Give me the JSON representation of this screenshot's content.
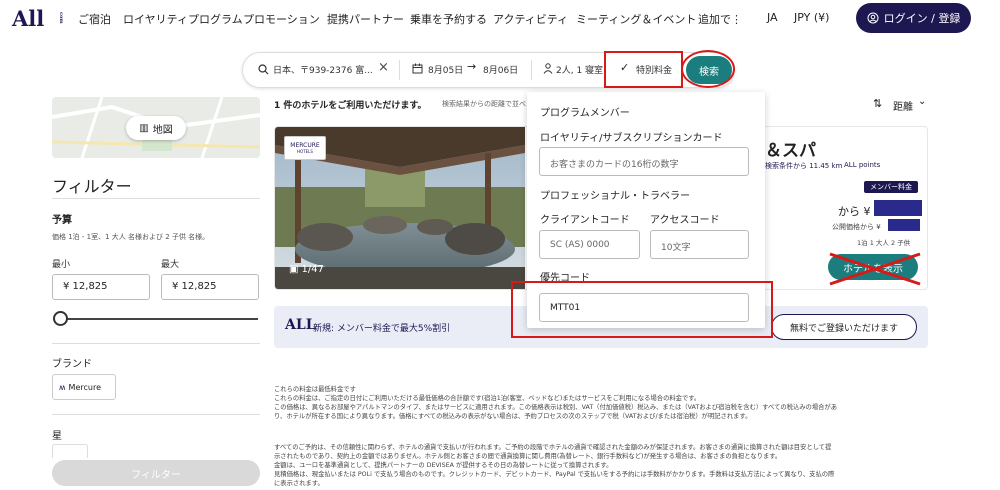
{
  "header": {
    "logo": "All",
    "logo_sub": "com",
    "nav": [
      "ご宿泊",
      "ロイヤリティプログラム",
      "プロモーション",
      "提携パートナー",
      "乗車を予約する",
      "アクティビティ",
      "ミーティング＆イベント",
      "追加で⋮"
    ],
    "language": "JA",
    "currency": "JPY (¥)",
    "login": "ログイン / 登録"
  },
  "search": {
    "destination": "日本、〒939-2376 富...",
    "checkin": "8月05日",
    "checkout": "8月06日",
    "guests": "2人, 1 寝室",
    "special_rates": "特別料金",
    "search_button": "検索"
  },
  "sidebar": {
    "map_button": "地図",
    "filter_title": "フィルター",
    "budget_label": "予算",
    "budget_note": "価格 1泊 - 1室、1 大人 名様および 2 子供 名様。",
    "min_label": "最小",
    "max_label": "最大",
    "min_value": "¥ 12,825",
    "max_value": "¥ 12,825",
    "brand_label": "ブランド",
    "brand_chip": "Mercure",
    "star_label": "星",
    "filter_button": "フィルター"
  },
  "results": {
    "count_text": "1 件のホテルをご利用いただけます。",
    "count_note": "検索結果からの距離で並べ",
    "sort_label": "距離",
    "hotel_name_partial": "＆スパ",
    "distance_text": "検索条件から 11.45 km",
    "all_points": "ALL points",
    "photo_counter": "1/47",
    "brand_logo": "MERCURE",
    "brand_logo_sub": "HOTELS",
    "member_badge": "メンバー料金",
    "price_from": "から ¥",
    "public_price": "公開価格から ¥",
    "per_night": "1泊 1 大人 2 子供",
    "view_hotel_button": "ホテルを表示"
  },
  "promo": {
    "logo": "ALL",
    "text": "新規: メンバー料金で最大5%割引",
    "button": "無料でご登録いただけます"
  },
  "fine_print": [
    "これらの料金は最低料金です",
    "これらの料金は、ご指定の日付にご利用いただける最低価格の合計額です(宿泊1泊(客室、ベッドなど)またはサービスをご利用になる場合の料金です。",
    "この価格は、異なるお部屋やアパルトマンのタイプ、またはサービスに適用されます。この価格表示は税別、VAT（付加価値税）税込み、または（VATおよび宿泊税を含む）すべての税込みの場合があ",
    "り、ホテルが所在する国により異なります。価格にすべての税込みの表示がない場合は、予約プロセスの次のステップで税（VATおよび/または宿泊税）が明記されます。",
    "すべてのご予約は、その信頼性に関わらず、ホテルの通貨で支払いが行われます。ご予約の段階でホテルの通貨で確認された金額のみが保証されます。お客さまの通貨に換算された額は目安として提",
    "示されたものであり、契約上の金額ではありません。ホテル側とお客さまの間で通貨換算に関し費用(為替レート、銀行手数料など)が発生する場合は、お客さまの負担となります。",
    "金額は、ユーロを基準通貨として、提携パートナーの DEVISEA が提供するその日の為替レートに従って換算されます。",
    "見積価格は、現金払いまたは POLi で支払う場合のものです。クレジットカード、デビットカード、PayPal で支払いをする予約には手数料がかかります。手数料は支払方法によって異なり、支払の際",
    "に表示されます。"
  ],
  "dropdown": {
    "program_member": "プログラムメンバー",
    "loyalty_label": "ロイヤリティ/サブスクリプションカード",
    "loyalty_placeholder": "お客さまのカードの16桁の数字",
    "professional": "プロフェッショナル・トラベラー",
    "client_code_label": "クライアントコード",
    "access_code_label": "アクセスコード",
    "client_code_placeholder": "SC (AS) 0000",
    "access_code_placeholder": "10文字",
    "preferred_code_label": "優先コード",
    "preferred_code_value": "MTT01"
  },
  "colors": {
    "brand_navy": "#1e1852",
    "teal": "#1b7d7d",
    "annotation_red": "#d61a1a"
  }
}
